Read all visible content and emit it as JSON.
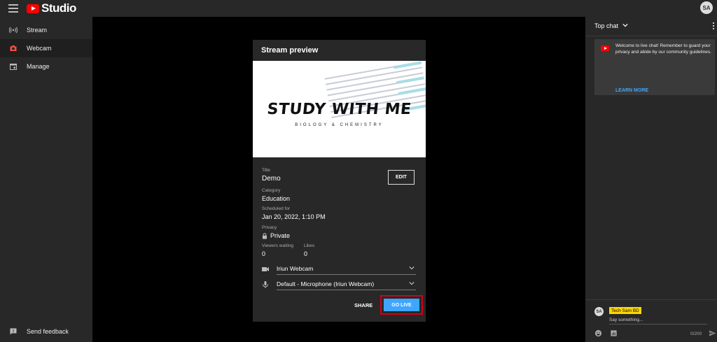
{
  "app": {
    "logo_text": "Studio",
    "avatar_initials": "SA"
  },
  "sidebar": {
    "items": [
      {
        "label": "Stream",
        "icon": "broadcast-icon"
      },
      {
        "label": "Webcam",
        "icon": "camera-icon",
        "active": true
      },
      {
        "label": "Manage",
        "icon": "calendar-icon"
      }
    ],
    "feedback_label": "Send feedback"
  },
  "preview": {
    "header": "Stream preview",
    "thumbnail": {
      "title": "STUDY WITH ME",
      "subtitle": "BIOLOGY & CHEMISTRY"
    },
    "title_label": "Title",
    "title_value": "Demo",
    "edit_label": "EDIT",
    "category_label": "Category",
    "category_value": "Education",
    "scheduled_label": "Scheduled for",
    "scheduled_value": "Jan 20, 2022, 1:10 PM",
    "privacy_label": "Privacy",
    "privacy_value": "Private",
    "viewers_label": "Viewers waiting",
    "viewers_value": "0",
    "likes_label": "Likes",
    "likes_value": "0",
    "camera_select": "Iriun Webcam",
    "mic_select": "Default - Microphone (Iriun Webcam)",
    "share_label": "SHARE",
    "go_live_label": "GO LIVE"
  },
  "chat": {
    "header": "Top chat",
    "welcome_text": "Welcome to live chat! Remember to guard your privacy and abide by our community guidelines.",
    "learn_more": "LEARN MORE",
    "username": "Tech Sam BD",
    "avatar_initials": "SA",
    "input_placeholder": "Say something...",
    "char_count": "0/200"
  },
  "colors": {
    "accent_blue": "#3ea6ff",
    "brand_red": "#ff0000",
    "highlight_outline": "#d0021b",
    "username_badge": "#ffd600",
    "panel_bg": "#282828"
  }
}
